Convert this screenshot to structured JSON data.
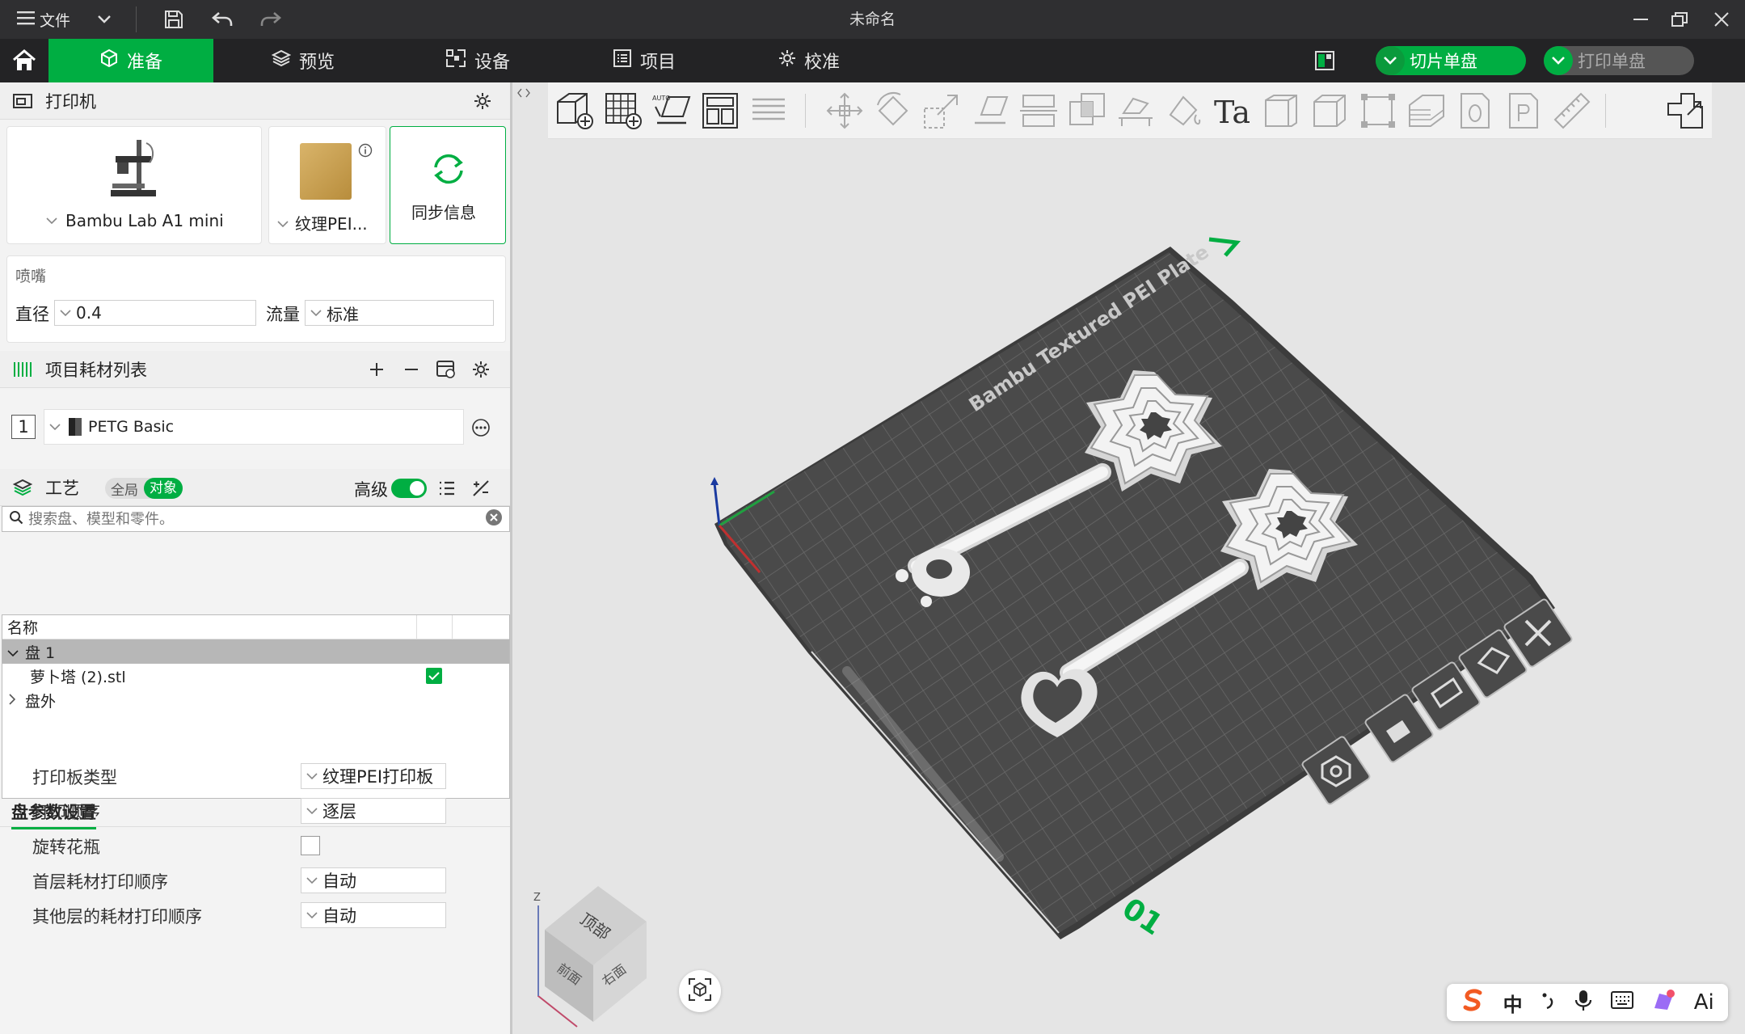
{
  "window": {
    "title": "未命名",
    "menu_label": "文件"
  },
  "nav": {
    "tabs": [
      {
        "label": "准备",
        "active": true
      },
      {
        "label": "预览",
        "active": false
      },
      {
        "label": "设备",
        "active": false
      },
      {
        "label": "项目",
        "active": false
      },
      {
        "label": "校准",
        "active": false
      }
    ],
    "slice_label": "切片单盘",
    "print_label": "打印单盘"
  },
  "printer": {
    "section_title": "打印机",
    "printer_name": "Bambu Lab A1 mini",
    "plate_name": "纹理PEI...",
    "sync_label": "同步信息",
    "nozzle_title": "喷嘴",
    "diameter_label": "直径",
    "diameter_value": "0.4",
    "flow_label": "流量",
    "flow_value": "标准"
  },
  "filament": {
    "section_title": "项目耗材列表",
    "slot_number": "1",
    "name": "PETG Basic"
  },
  "process": {
    "section_title": "工艺",
    "toggle_global": "全局",
    "toggle_object": "对象",
    "advanced_label": "高级",
    "search_placeholder": "搜索盘、模型和零件。"
  },
  "tree": {
    "header": "名称",
    "plate_label": "盘 1",
    "object_label": "萝卜塔 (2).stl",
    "outside_label": "盘外"
  },
  "plate_settings": {
    "tab_label": "盘参数设置",
    "rows": [
      {
        "label": "打印板类型",
        "value": "纹理PEI打印板"
      },
      {
        "label": "打印顺序",
        "value": "逐层"
      },
      {
        "label": "旋转花瓶",
        "value": ""
      },
      {
        "label": "首层耗材打印顺序",
        "value": "自动"
      },
      {
        "label": "其他层的耗材打印顺序",
        "value": "自动"
      }
    ]
  },
  "viewport": {
    "bed_label": "Bambu Textured PEI Plate",
    "plate_number": "01",
    "cube_top": "顶部",
    "cube_front": "前面",
    "cube_right": "右面",
    "axis_z": "Z",
    "toolbar_auto": "AUTO",
    "toolbar_text": "Ta"
  },
  "ime": {
    "lang": "中",
    "ai_label": "Ai"
  },
  "colors": {
    "accent": "#00ae42",
    "titlebar": "#2f2f31",
    "navbar": "#232325",
    "bed": "#4a4a4a"
  }
}
